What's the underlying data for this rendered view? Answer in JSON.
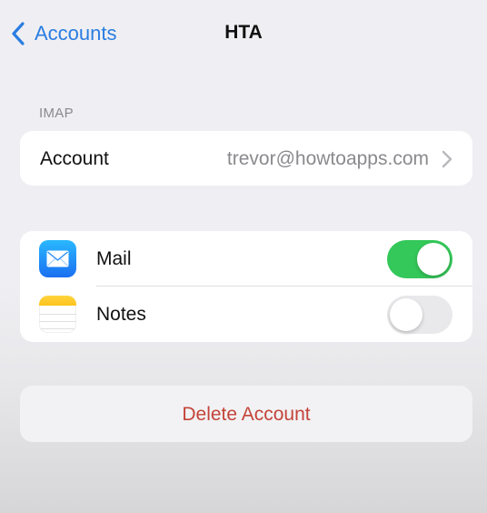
{
  "nav": {
    "back_label": "Accounts",
    "title": "HTA"
  },
  "imap_section": {
    "header": "IMAP",
    "account_label": "Account",
    "account_value": "trevor@howtoapps.com"
  },
  "toggles": [
    {
      "label": "Mail",
      "icon": "mail-icon",
      "on": true
    },
    {
      "label": "Notes",
      "icon": "notes-icon",
      "on": false
    }
  ],
  "delete_label": "Delete Account",
  "colors": {
    "accent": "#2a7de1",
    "switch_on": "#34c759",
    "switch_off": "#e9e9eb",
    "destructive": "#c4443a",
    "secondary_text": "#8a8a8e"
  }
}
